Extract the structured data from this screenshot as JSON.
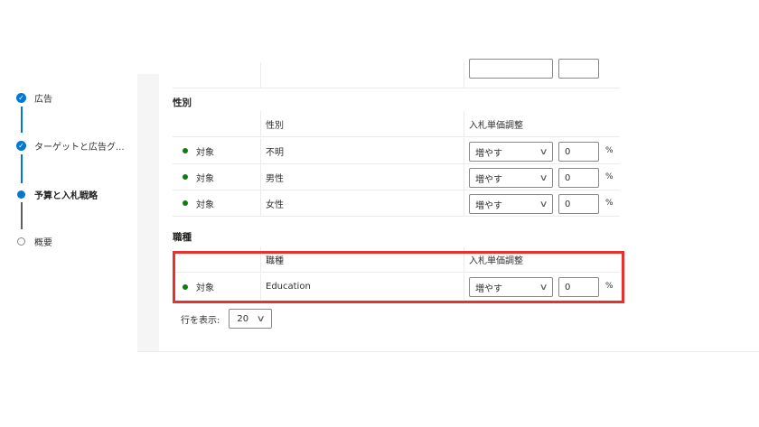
{
  "stepper": {
    "steps": [
      {
        "label": "広告",
        "state": "done"
      },
      {
        "label": "ターゲットと広告グ...",
        "state": "done"
      },
      {
        "label": "予算と入札戦略",
        "state": "current"
      },
      {
        "label": "概要",
        "state": "pending"
      }
    ]
  },
  "gender": {
    "title": "性別",
    "headers": {
      "col2": "性別",
      "col3": "入札単価調整"
    },
    "rows": [
      {
        "status": "対象",
        "name": "不明",
        "adjust": "増やす",
        "value": "0",
        "unit": "%"
      },
      {
        "status": "対象",
        "name": "男性",
        "adjust": "増やす",
        "value": "0",
        "unit": "%"
      },
      {
        "status": "対象",
        "name": "女性",
        "adjust": "増やす",
        "value": "0",
        "unit": "%"
      }
    ]
  },
  "job": {
    "title": "職種",
    "headers": {
      "col2": "職種",
      "col3": "入札単価調整"
    },
    "rows": [
      {
        "status": "対象",
        "name": "Education",
        "adjust": "増やす",
        "value": "0",
        "unit": "%"
      }
    ]
  },
  "pager": {
    "label": "行を表示:",
    "value": "20"
  },
  "colors": {
    "accent": "#0078d4",
    "status_green": "#107c10",
    "highlight": "#e8302d"
  }
}
